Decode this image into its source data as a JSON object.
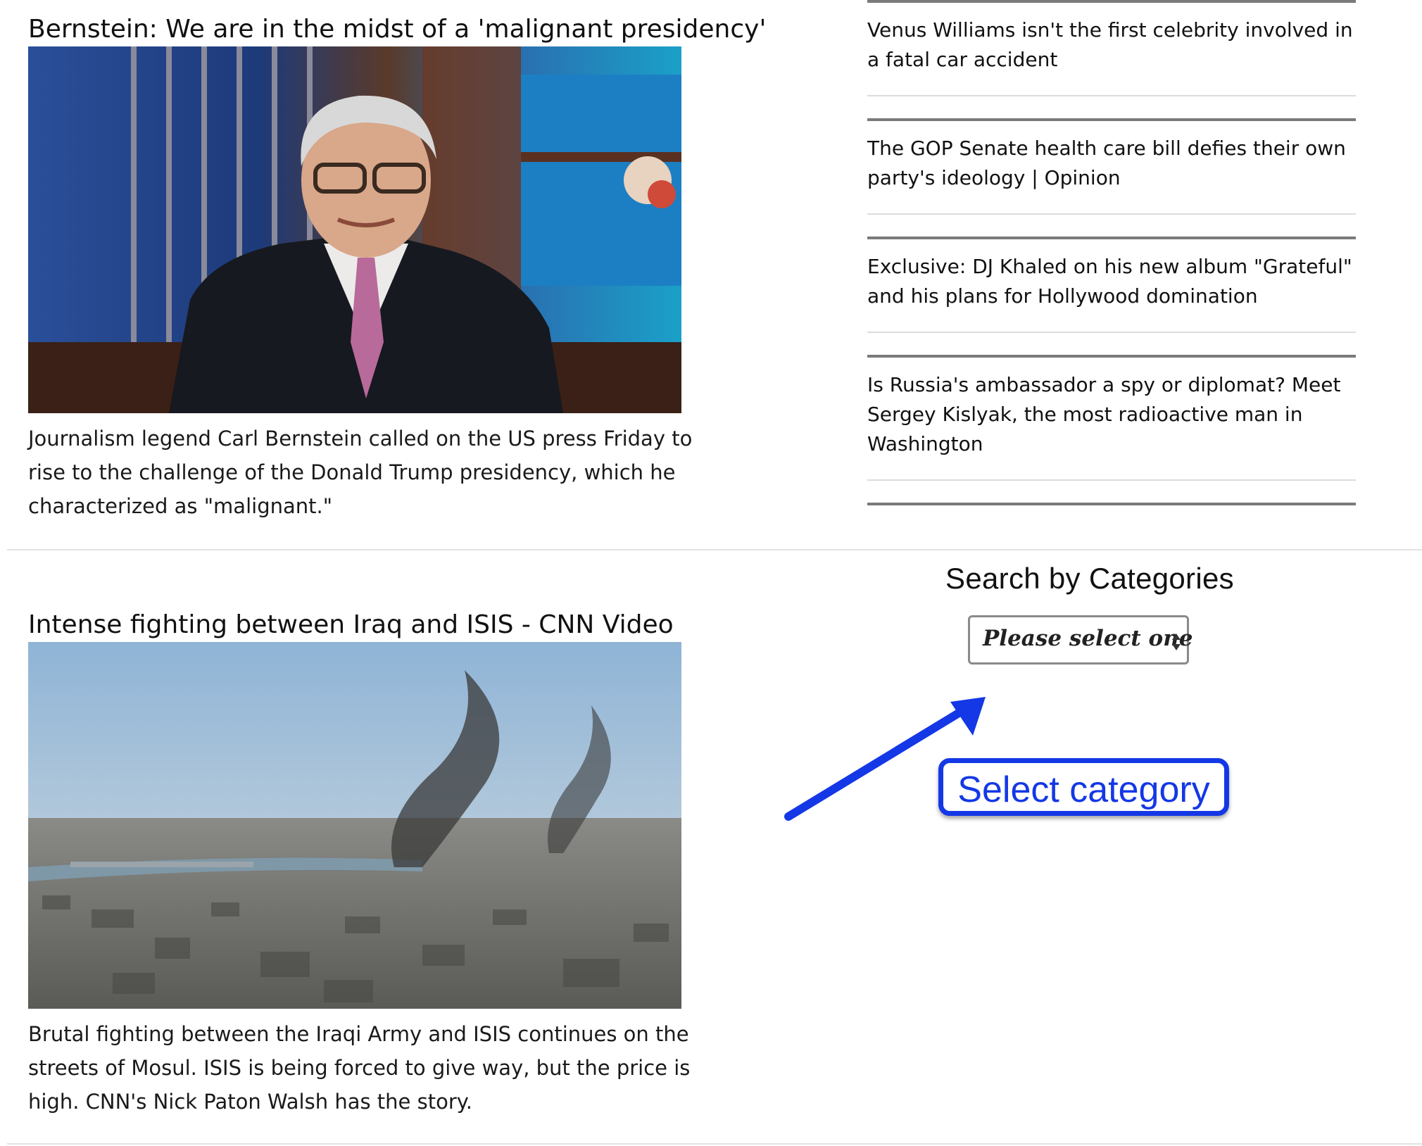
{
  "articles": [
    {
      "title": "Bernstein: We are in the midst of a 'malignant presidency'",
      "description": "Journalism legend Carl Bernstein called on the US press Friday to rise to the challenge of the Donald Trump presidency, which he characterized as \"malignant.\""
    },
    {
      "title": "Intense fighting between Iraq and ISIS - CNN Video",
      "description": "Brutal fighting between the Iraqi Army and ISIS continues on the streets of Mosul. ISIS is being forced to give way, but the price is high. CNN's Nick Paton Walsh has the story."
    }
  ],
  "headlines": [
    "Venus Williams isn't the first celebrity involved in a fatal car accident",
    "The GOP Senate health care bill defies their own party's ideology | Opinion",
    "Exclusive: DJ Khaled on his new album \"Grateful\" and his plans for Hollywood domination",
    "Is Russia's ambassador a spy or diplomat? Meet Sergey Kislyak, the most radioactive man in Washington"
  ],
  "search": {
    "title": "Search by Categories",
    "select_value": "Please select one"
  },
  "annotation": {
    "label": "Select category",
    "color": "#1438e6"
  }
}
